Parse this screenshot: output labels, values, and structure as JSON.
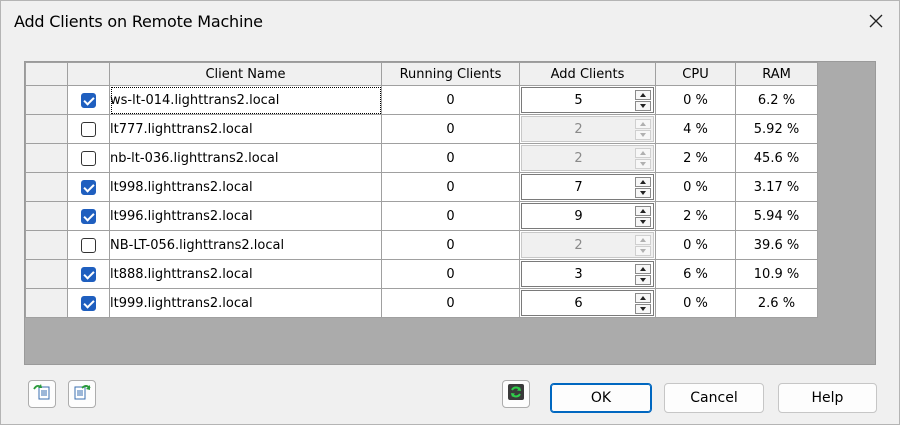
{
  "window": {
    "title": "Add Clients on Remote Machine"
  },
  "grid": {
    "headers": {
      "client_name": "Client Name",
      "running_clients": "Running Clients",
      "add_clients": "Add Clients",
      "cpu": "CPU",
      "ram": "RAM"
    },
    "rows": [
      {
        "checked": true,
        "name": "ws-lt-014.lighttrans2.local",
        "running": "0",
        "add": "5",
        "add_enabled": true,
        "cpu": "0 %",
        "ram": "6.2 %"
      },
      {
        "checked": false,
        "name": "lt777.lighttrans2.local",
        "running": "0",
        "add": "2",
        "add_enabled": false,
        "cpu": "4 %",
        "ram": "5.92 %"
      },
      {
        "checked": false,
        "name": "nb-lt-036.lighttrans2.local",
        "running": "0",
        "add": "2",
        "add_enabled": false,
        "cpu": "2 %",
        "ram": "45.6 %"
      },
      {
        "checked": true,
        "name": "lt998.lighttrans2.local",
        "running": "0",
        "add": "7",
        "add_enabled": true,
        "cpu": "0 %",
        "ram": "3.17 %"
      },
      {
        "checked": true,
        "name": "lt996.lighttrans2.local",
        "running": "0",
        "add": "9",
        "add_enabled": true,
        "cpu": "2 %",
        "ram": "5.94 %"
      },
      {
        "checked": false,
        "name": "NB-LT-056.lighttrans2.local",
        "running": "0",
        "add": "2",
        "add_enabled": false,
        "cpu": "0 %",
        "ram": "39.6 %"
      },
      {
        "checked": true,
        "name": "lt888.lighttrans2.local",
        "running": "0",
        "add": "3",
        "add_enabled": true,
        "cpu": "6 %",
        "ram": "10.9 %"
      },
      {
        "checked": true,
        "name": "lt999.lighttrans2.local",
        "running": "0",
        "add": "6",
        "add_enabled": true,
        "cpu": "0 %",
        "ram": "2.6 %"
      }
    ]
  },
  "footer": {
    "ok_label": "OK",
    "cancel_label": "Cancel",
    "help_label": "Help",
    "icons": [
      "import-icon",
      "export-icon",
      "refresh-icon"
    ]
  },
  "colors": {
    "checkbox_accent": "#1f5fbf",
    "default_button_border": "#0067c0",
    "grid_background": "#ababab"
  }
}
